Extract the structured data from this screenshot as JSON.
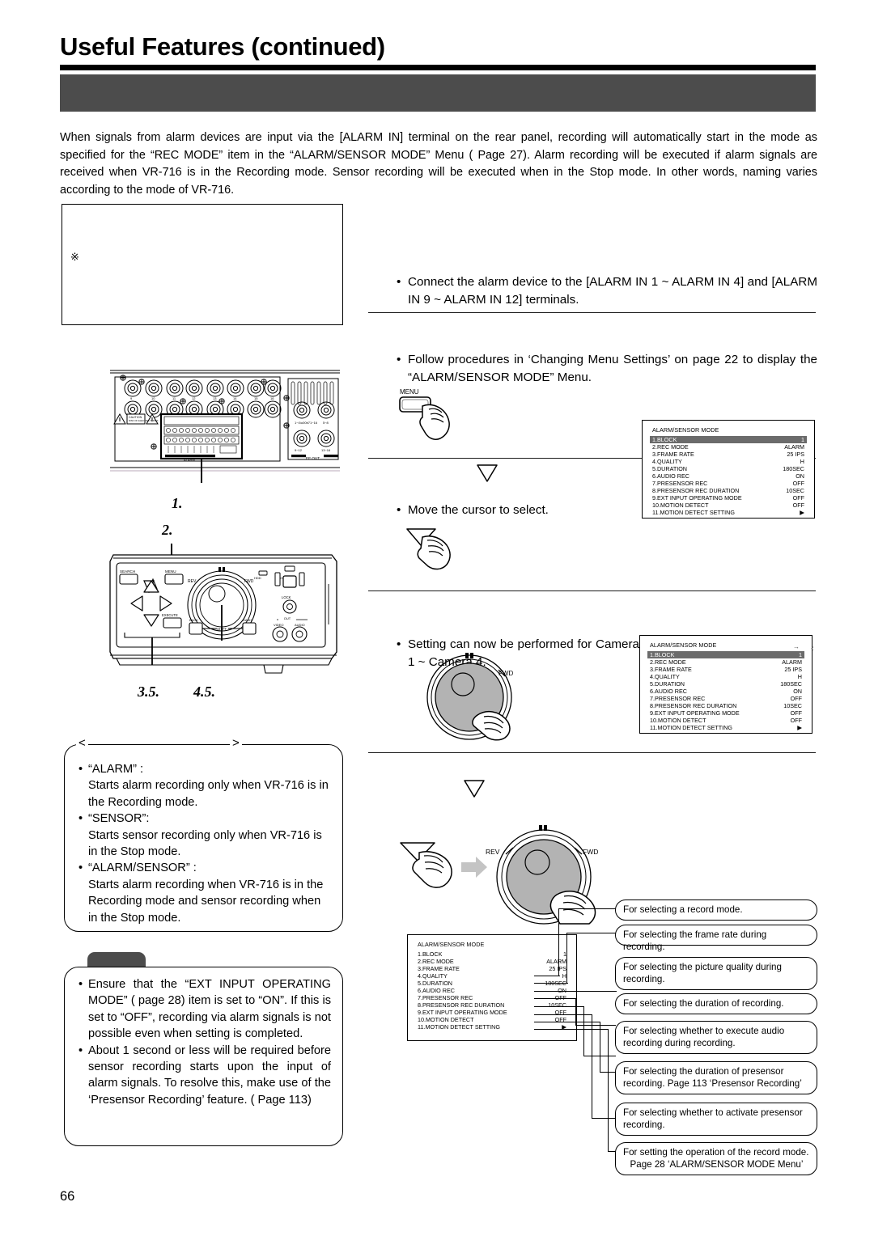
{
  "header": {
    "title": "Useful Features (continued)",
    "band_text": ""
  },
  "intro": {
    "text": "When signals from alarm devices are input via the [ALARM IN] terminal on the rear panel, recording will automatically start in the mode as specified for the “REC MODE” item in the “ALARM/SENSOR MODE” Menu (   Page 27). Alarm recording will be executed if alarm signals are received when VR-716 is in the Recording mode. Sensor recording will be executed when in the Stop mode. In other words, naming varies according to the mode of VR-716."
  },
  "figure_box": {
    "marker": "※",
    "caption": ""
  },
  "steps": [
    {
      "id": "step-1",
      "bullet": "•",
      "text": "Connect the alarm device to the [ALARM IN 1 ~ ALARM IN 4] and [ALARM IN 9 ~ ALARM IN 12] terminals."
    },
    {
      "id": "step-2",
      "bullet": "•",
      "text": "Follow procedures in ‘Changing Menu Settings’ on page 22 to display the “ALARM/SENSOR MODE” Menu."
    },
    {
      "id": "step-3",
      "bullet": "•",
      "text": "Move the cursor to select."
    },
    {
      "id": "step-4",
      "bullet": "•",
      "text": "Setting can now be performed for Camera 1 ~ Camera 4."
    }
  ],
  "step_numbers": {
    "rear_panel": "1.",
    "front_panel_top": "2.",
    "arrows": "3.5.",
    "jog": "4.5."
  },
  "device": {
    "rear_labels": {
      "alarm": "ALARM",
      "ee_out": "EE OUT",
      "caution": "CAUTION",
      "range_1": "1~4・–—16",
      "range_2": "5~8",
      "range_3": "9~12",
      "range_4": "13~16"
    },
    "front_labels": {
      "search": "SEARCH",
      "menu": "MENU",
      "execute": "EXECUTE",
      "rev": "REV",
      "fwd": "FWD",
      "hdd": "HDD",
      "operate": "OPERATE",
      "lock": "LOCK",
      "out": "OUT",
      "video": "VIDEO",
      "audio": "AUDIO",
      "shift": "SHIFT",
      "back": "BACK",
      "dash": "DASH"
    },
    "menu_button_label": "MENU",
    "jog_rev": "REV",
    "jog_fwd": "FWD"
  },
  "osd_menu": {
    "title": "ALARM/SENSOR MODE",
    "rows": [
      {
        "label": "1.BLOCK",
        "value": "1",
        "selected": true
      },
      {
        "label": "2.REC MODE",
        "value": "ALARM",
        "selected": false
      },
      {
        "label": "3.FRAME RATE",
        "value": "25 IPS",
        "selected": false
      },
      {
        "label": "4.QUALITY",
        "value": "H",
        "selected": false
      },
      {
        "label": "5.DURATION",
        "value": "180SEC",
        "selected": false
      },
      {
        "label": "6.AUDIO REC",
        "value": "ON",
        "selected": false
      },
      {
        "label": "7.PRESENSOR REC",
        "value": "OFF",
        "selected": false
      },
      {
        "label": "8.PRESENSOR REC DURATION",
        "value": "10SEC",
        "selected": false
      },
      {
        "label": "9.EXT INPUT OPERATING MODE",
        "value": "OFF",
        "selected": false
      },
      {
        "label": "10.MOTION DETECT",
        "value": "OFF",
        "selected": false
      },
      {
        "label": "11.MOTION DETECT SETTING",
        "value": "▶",
        "selected": false
      }
    ],
    "third_rows": [
      {
        "label": "1.BLOCK",
        "value": "1",
        "selected": false
      },
      {
        "label": "2.REC MODE",
        "value": "ALARM",
        "selected": false
      },
      {
        "label": "3.FRAME RATE",
        "value": "25 IPS",
        "selected": false
      },
      {
        "label": "4.QUALITY",
        "value": "H",
        "selected": false
      },
      {
        "label": "5.DURATION",
        "value": "180SEC",
        "selected": false
      },
      {
        "label": "6.AUDIO REC",
        "value": "ON",
        "selected": false
      },
      {
        "label": "7.PRESENSOR REC",
        "value": "OFF",
        "selected": false
      },
      {
        "label": "8.PRESENSOR REC DURATION",
        "value": "10SEC",
        "selected": false
      },
      {
        "label": "9.EXT INPUT OPERATING MODE",
        "value": "OFF",
        "selected": false
      },
      {
        "label": "10.MOTION DETECT",
        "value": "OFF",
        "selected": false
      },
      {
        "label": "11.MOTION DETECT SETTING",
        "value": "▶",
        "selected": false
      }
    ]
  },
  "mode_box": {
    "angle_open": "<",
    "angle_close": ">",
    "items": [
      {
        "bullet": "•",
        "title": "“ALARM” :",
        "body": "Starts alarm recording only when VR-716 is in the Recording mode."
      },
      {
        "bullet": "•",
        "title": "“SENSOR”:",
        "body": "Starts sensor recording only when VR-716 is in the Stop mode."
      },
      {
        "bullet": "•",
        "title": "“ALARM/SENSOR” :",
        "body": "Starts alarm recording when VR-716 is in the Recording mode and sensor recording when in the Stop mode."
      }
    ]
  },
  "note_box": {
    "tab_label": "",
    "items": [
      {
        "bullet": "•",
        "text": "Ensure that the “EXT INPUT OPERATING MODE” (   page 28) item is set to “ON”. If this is set to “OFF”, recording via alarm signals is not possible even when setting is completed."
      },
      {
        "bullet": "•",
        "text": "About 1 second or less will be required before sensor recording starts upon the input of alarm signals. To resolve this, make use of the ‘Presensor Recording’ feature. (   Page 113)"
      }
    ]
  },
  "callouts": [
    {
      "id": "callout-rec-mode",
      "line1": "For selecting a record mode.",
      "line2": ""
    },
    {
      "id": "callout-frame-rate",
      "line1": "For selecting the frame rate during recording.",
      "line2": ""
    },
    {
      "id": "callout-quality",
      "line1": "For selecting the picture quality during",
      "line2": "recording."
    },
    {
      "id": "callout-duration",
      "line1": "For selecting the duration of recording.",
      "line2": ""
    },
    {
      "id": "callout-audio-rec",
      "line1": "For selecting whether to execute audio",
      "line2": "recording during recording."
    },
    {
      "id": "callout-presensor-dur",
      "line1": "For selecting the duration of presensor",
      "line2": "recording.    Page 113 ‘Presensor Recording’"
    },
    {
      "id": "callout-presensor-rec",
      "line1": "For selecting whether to activate presensor",
      "line2": "recording."
    },
    {
      "id": "callout-ext-input",
      "line1": "For setting the operation of the record mode.",
      "line2": "Page 28 ‘ALARM/SENSOR MODE Menu’"
    }
  ],
  "footer": {
    "page_number": "66"
  },
  "colors": {
    "band": "#4c4c4c",
    "osd_highlight": "#6b6b6b",
    "ink": "#000000",
    "jog_fill": "#b3b3b3"
  }
}
